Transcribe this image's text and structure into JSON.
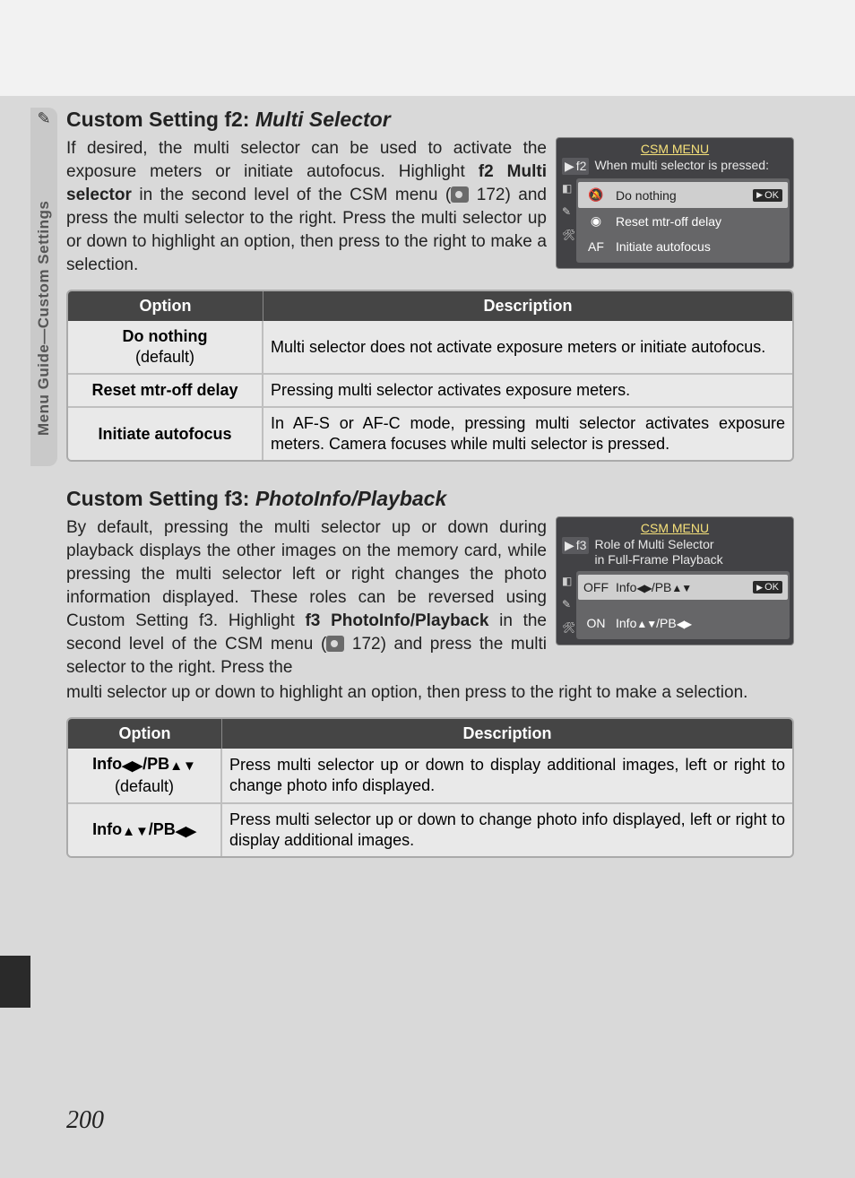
{
  "sidebar": {
    "label": "Menu Guide—Custom Settings"
  },
  "section_f2": {
    "title_prefix": "Custom Setting f2: ",
    "title_italic": "Multi Selector",
    "para_1": "If desired, the multi selector can be used to activate the exposure meters or initiate autofocus. Highlight ",
    "para_bold": "f2 Multi selector",
    "para_2": " in the second level of the CSM menu (",
    "ref_page": " 172) and press the multi selector to the right.  Press the multi selector up or down to highlight an option, then press to the right to make a selection.",
    "lcd": {
      "title": "CSM MENU",
      "tag_code": "f2",
      "subtitle": "When multi selector is pressed:",
      "rows": [
        {
          "code": "",
          "icon": "🔕",
          "label": "Do nothing",
          "selected": true,
          "ok": "OK"
        },
        {
          "code": "",
          "icon": "◉",
          "label": "Reset mtr-off delay",
          "selected": false
        },
        {
          "code": "AF",
          "icon": "",
          "label": "Initiate autofocus",
          "selected": false
        }
      ]
    },
    "table": {
      "head_option": "Option",
      "head_desc": "Description",
      "rows": [
        {
          "opt_main": "Do nothing",
          "opt_sub": "(default)",
          "desc": "Multi selector does not activate exposure meters or initiate autofocus."
        },
        {
          "opt_main": "Reset mtr-off delay",
          "opt_sub": "",
          "desc": "Pressing multi selector activates exposure meters."
        },
        {
          "opt_main": "Initiate autofocus",
          "opt_sub": "",
          "desc": "In AF-S or AF-C mode, pressing multi selector activates exposure meters.  Camera focuses while multi selector is pressed."
        }
      ]
    }
  },
  "section_f3": {
    "title_prefix": "Custom Setting f3: ",
    "title_italic": "PhotoInfo/Playback",
    "para_1": "By default, pressing the multi selector up or down during playback displays the other images on the memory card, while pressing the multi selector left or right changes the photo information displayed.  These roles can be reversed using Custom Setting f3.  Highlight ",
    "para_bold": "f3 PhotoInfo/Playback",
    "para_2": " in the second level of the CSM menu (",
    "ref_page": " 172) and press the multi selector to the right.  Press the ",
    "para_tail": "multi selector up or down to highlight an option, then press to the right to make a selection.",
    "lcd": {
      "title": "CSM MENU",
      "tag_code": "f3",
      "subtitle_l1": "Role of Multi Selector",
      "subtitle_l2": "in Full-Frame Playback",
      "rows": [
        {
          "code": "OFF",
          "label_pre": "Info",
          "dir1": "◀▶",
          "mid": "/PB",
          "dir2": "▲▼",
          "selected": true,
          "ok": "OK"
        },
        {
          "code": "ON",
          "label_pre": "Info",
          "dir1": "▲▼",
          "mid": "/PB",
          "dir2": "◀▶",
          "selected": false
        }
      ]
    },
    "table": {
      "head_option": "Option",
      "head_desc": "Description",
      "rows": [
        {
          "opt_pre": "Info",
          "dir1": "◀▶",
          "mid": "/PB",
          "dir2": "▲▼",
          "opt_sub": "(default)",
          "desc": "Press multi selector up or down to display additional images, left or right to change photo info displayed."
        },
        {
          "opt_pre": "Info",
          "dir1": "▲▼",
          "mid": "/PB",
          "dir2": "◀▶",
          "opt_sub": "",
          "desc": "Press multi selector up or down to change photo info displayed, left or right to display additional images."
        }
      ]
    }
  },
  "page_number": "200"
}
